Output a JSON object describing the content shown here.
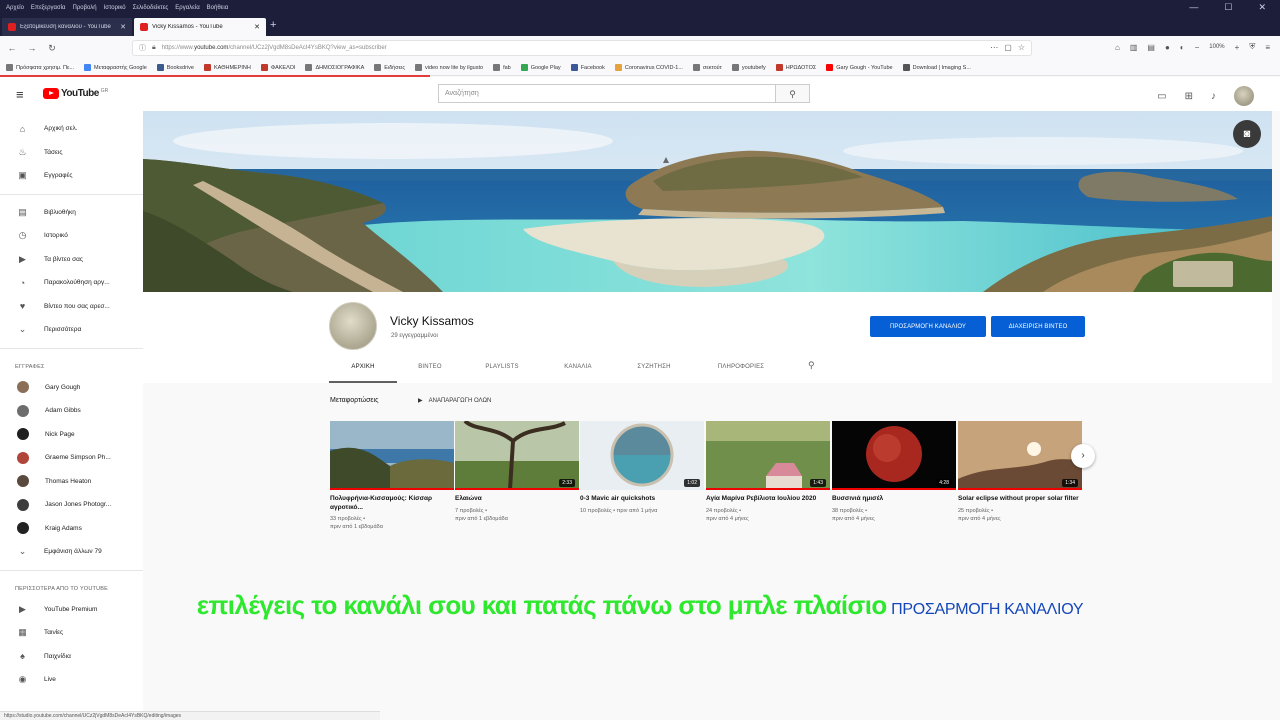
{
  "os_menu": [
    "Αρχείο",
    "Επεξεργασία",
    "Προβολή",
    "Ιστορικό",
    "Σελιδοδείκτες",
    "Εργαλεία",
    "Βοήθεια"
  ],
  "tabs": [
    {
      "title": "Εξατομίκευση καναλιού - YouTube"
    },
    {
      "title": "Vicky Kissamos - YouTube"
    }
  ],
  "url": {
    "prefix": "https://www.",
    "host": "youtube.com",
    "path": "/channel/UCz2jVgdM8sDeAcI4YsBKQ?view_as=subscriber"
  },
  "zoom": "100%",
  "bookmarks": [
    "Πρόσφατα χρησιμ. Πε...",
    "Μεταφραστής Google",
    "Booksdrive",
    "ΚΑΘΗΜΕΡΙΝΗ",
    "ΦΑΚΕΛΟΙ",
    "ΔΗΜΟΣΙΟΓΡΑΦΙΚΑ",
    "Ειδήσεις",
    "video now lite by ilgusto",
    "fab",
    "Google Play",
    "Facebook",
    "Coronavirus COVID-1...",
    "σεκτούτ",
    "youtubefy",
    "ΗΡΩΔΟΤΟΣ",
    "Gary Gough - YouTube",
    "Download | Imaging S..."
  ],
  "youtube": {
    "logo_text": "YouTube",
    "region": "GR",
    "search_placeholder": "Αναζήτηση"
  },
  "sidebar": {
    "main": [
      {
        "label": "Αρχική σελ.",
        "icon": "home-icon",
        "glyph": "⌂"
      },
      {
        "label": "Τάσεις",
        "icon": "trending-icon",
        "glyph": "♨"
      },
      {
        "label": "Εγγραφές",
        "icon": "subscriptions-icon",
        "glyph": "▣"
      }
    ],
    "library": [
      {
        "label": "Βιβλιοθήκη",
        "icon": "library-icon",
        "glyph": "▤"
      },
      {
        "label": "Ιστορικό",
        "icon": "history-icon",
        "glyph": "◷"
      },
      {
        "label": "Τα βίντεο σας",
        "icon": "your-videos-icon",
        "glyph": "▶"
      },
      {
        "label": "Παρακολούθηση αργ...",
        "icon": "watch-later-icon",
        "glyph": "◔"
      },
      {
        "label": "Βίντεο που σας αρεσ...",
        "icon": "liked-videos-icon",
        "glyph": "♥"
      },
      {
        "label": "Περισσότερα",
        "icon": "chevron-down-icon",
        "glyph": "⌄"
      }
    ],
    "subscriptions_heading": "ΕΓΓΡΑΦΕΣ",
    "subscriptions": [
      {
        "label": "Gary Gough",
        "color": "#8a6f56"
      },
      {
        "label": "Adam Gibbs",
        "color": "#6d6d6d"
      },
      {
        "label": "Nick Page",
        "color": "#1f1f1f"
      },
      {
        "label": "Graeme Simpson Ph...",
        "color": "#b0453a"
      },
      {
        "label": "Thomas Heaton",
        "color": "#5a4a3e"
      },
      {
        "label": "Jason Jones Photogr...",
        "color": "#3d3d3d"
      },
      {
        "label": "Kraig Adams",
        "color": "#222222"
      }
    ],
    "show_more": "Εμφάνιση άλλων 79",
    "more_heading": "ΠΕΡΙΣΣΟΤΕΡΑ ΑΠΟ ΤΟ YOUTUBE",
    "more": [
      {
        "label": "YouTube Premium",
        "icon": "youtube-premium-icon",
        "glyph": "▶"
      },
      {
        "label": "Ταινίες",
        "icon": "movies-icon",
        "glyph": "▦"
      },
      {
        "label": "Παιχνίδια",
        "icon": "gaming-icon",
        "glyph": "♠"
      },
      {
        "label": "Live",
        "icon": "live-icon",
        "glyph": "◉"
      }
    ]
  },
  "channel": {
    "name": "Vicky Kissamos",
    "subscribers": "29 εγγεγραμμένοι",
    "customize_button": "ΠΡΟΣΑΡΜΟΓΗ ΚΑΝΑΛΙΟΥ",
    "manage_button": "ΔΙΑΧΕΙΡΙΣΗ ΒΙΝΤΕΟ",
    "tabs": [
      "ΑΡΧΙΚΗ",
      "ΒΙΝΤΕΟ",
      "PLAYLISTS",
      "ΚΑΝΑΛΙΑ",
      "ΣΥΖΗΤΗΣΗ",
      "ΠΛΗΡΟΦΟΡΙΕΣ"
    ]
  },
  "section": {
    "title": "Μεταφορτώσεις",
    "play_all": "ΑΝΑΠΑΡΑΓΩΓΗ ΟΛΩΝ"
  },
  "videos": [
    {
      "title": "Πολυφρήνια-Κισσαμούς: Κίσσαρ αγροτικό...",
      "views": "33 προβολές •",
      "age": "πριν από 1 εβδομάδα",
      "duration": ""
    },
    {
      "title": "Ελαιώνα",
      "views": "7 προβολές •",
      "age": "πριν από 1 εβδομάδα",
      "duration": "2:33"
    },
    {
      "title": "0-3 Mavic air quickshots",
      "views": "10 προβολές • πριν από 1 μήνα",
      "age": "",
      "duration": "1:02"
    },
    {
      "title": "Αγία Μαρίνα Ρεβίλιοτα Ιουλίου 2020",
      "views": "24 προβολές •",
      "age": "πριν από 4 μήνες",
      "duration": "1:43"
    },
    {
      "title": "Βυσσινιά ημισέλ",
      "views": "38 προβολές •",
      "age": "πριν από 4 μήνες",
      "duration": "4:28"
    },
    {
      "title": "Solar eclipse without proper solar filter",
      "views": "25 προβολές •",
      "age": "πριν από 4 μήνες",
      "duration": "1:34"
    }
  ],
  "caption": {
    "main": "επιλέγεις το κανάλι σου και πατάς πάνω στο μπλε πλαίσιο",
    "highlight": "ΠΡΟΣΑΡΜΟΓΗ ΚΑΝΑΛΙΟΥ"
  },
  "status_url": "https://studio.youtube.com/channel/UCz2jVgdM8sDeAcI4YsBKQ/editing/images",
  "colors": {
    "youtube_red": "#ff0000",
    "button_blue": "#065fd4",
    "caption_green": "#2ee82e",
    "caption_blue": "#1447b8"
  }
}
